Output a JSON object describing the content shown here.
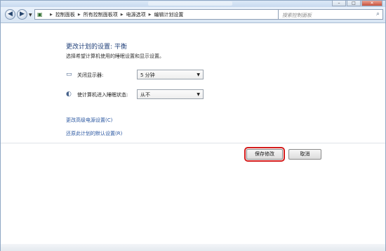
{
  "window": {
    "controls": [
      "–",
      "□",
      "✕"
    ]
  },
  "nav": {
    "breadcrumbs": [
      "控制面板",
      "所有控制面板项",
      "电源选项",
      "编辑计划设置"
    ],
    "search_placeholder": "搜索控制面板"
  },
  "main": {
    "title": "更改计划的设置: 平衡",
    "subtitle": "选择希望计算机使用的睡眠设置和显示设置。",
    "settings": [
      {
        "label": "关闭显示器:",
        "value": "5 分钟",
        "icon": "monitor-icon"
      },
      {
        "label": "使计算机进入睡眠状态:",
        "value": "从不",
        "icon": "moon-sleep-icon"
      }
    ],
    "links": [
      "更改高级电源设置(C)",
      "还原此计划的默认设置(R)"
    ]
  },
  "buttons": {
    "save": "保存修改",
    "cancel": "取消"
  },
  "colors": {
    "highlight": "#d41c1c",
    "link": "#2c58a2",
    "title": "#1f3f79"
  }
}
